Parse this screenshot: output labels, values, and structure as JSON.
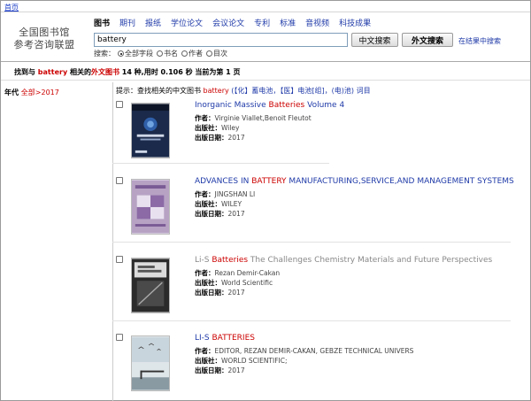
{
  "nav": {
    "home": "首页"
  },
  "logo": {
    "line1": "全国图书馆",
    "line2": "参考咨询联盟"
  },
  "tabs": [
    "图书",
    "期刊",
    "报纸",
    "学位论文",
    "会议论文",
    "专利",
    "标准",
    "音视频",
    "科技成果"
  ],
  "search": {
    "value": "battery",
    "btn_cn": "中文搜索",
    "btn_en": "外文搜索",
    "in_result": "在结果中搜索"
  },
  "scope": {
    "label": "搜索：",
    "options": [
      "全部字段",
      "书名",
      "作者",
      "目次"
    ],
    "selected": 0
  },
  "summary": {
    "pre": "找到与",
    "keyword": "battery",
    "mid": "相关的",
    "cat": "外文图书",
    "post": "14 种,用时 0.106 秒 当前为第 1 页"
  },
  "facet": {
    "label": "年代",
    "value": "全部>2017"
  },
  "hint": {
    "prefix": "提示：查找相关的中文图书",
    "keyword": "battery",
    "open": "(",
    "link1": "【化】蓄电池",
    "comma1": "，",
    "link2": "【医】电池[组]",
    "comma2": "，",
    "link3": "(电)池",
    "close": ")",
    "word": "词目"
  },
  "colors": {
    "link": "#1f3aa8",
    "highlight": "#cc0000",
    "title_gray": "#888888"
  },
  "results": [
    {
      "title_pre": "Inorganic Massive ",
      "title_hl": "Batteries",
      "title_post": " Volume 4",
      "title_color": "#1f3aa8",
      "hl_color": "#cc0000",
      "author_label": "作者：",
      "author": "Virginie Viallet,Benoit Fleutot",
      "pub_label": "出版社：",
      "pub": "Wiley",
      "date_label": "出版日期：",
      "date": "2017",
      "cover_text": "Inorganic Massive Batteries"
    },
    {
      "title_pre": "ADVANCES IN ",
      "title_hl": "BATTERY",
      "title_post": " MANUFACTURING,SERVICE,AND MANAGEMENT SYSTEMS",
      "title_color": "#1f3aa8",
      "hl_color": "#cc0000",
      "author_label": "作者：",
      "author": "JINGSHAN LI",
      "pub_label": "出版社：",
      "pub": "WILEY",
      "date_label": "出版日期：",
      "date": "2017",
      "cover_text": "Advances in Battery Manufacturing"
    },
    {
      "title_pre": "Li-S ",
      "title_hl": "Batteries",
      "title_post": " The Challenges Chemistry Materials and Future Perspectives",
      "title_color": "#888888",
      "hl_color": "#cc0000",
      "author_label": "作者：",
      "author": "Rezan Demir-Cakan",
      "pub_label": "出版社：",
      "pub": "World Scientific",
      "date_label": "出版日期：",
      "date": "2017",
      "cover_text": "Li-S Batteries"
    },
    {
      "title_pre": "LI-S ",
      "title_hl": "BATTERIES",
      "title_post": "",
      "title_color": "#1f3aa8",
      "hl_color": "#cc0000",
      "author_label": "作者：",
      "author": "EDITOR, REZAN DEMIR-CAKAN, GEBZE TECHNICAL UNIVERS",
      "pub_label": "出版社：",
      "pub": "WORLD SCIENTIFIC;",
      "date_label": "出版日期：",
      "date": "2017",
      "cover_text": ""
    }
  ]
}
